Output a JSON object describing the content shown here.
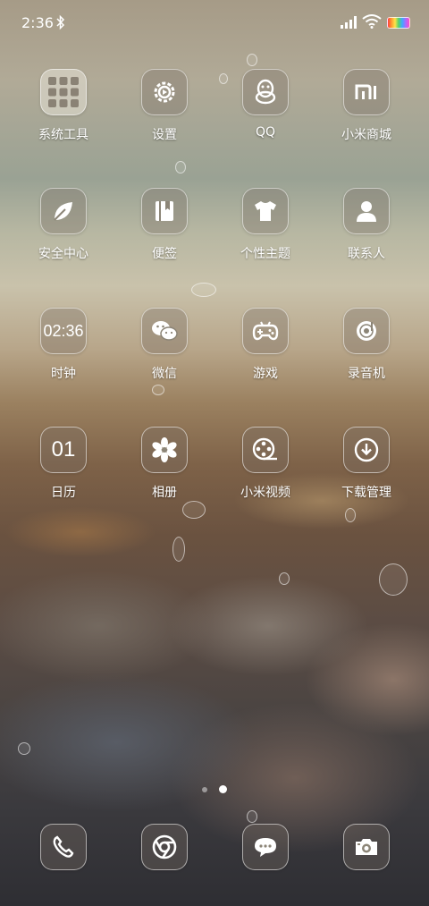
{
  "status_bar": {
    "time": "2:36",
    "icons": [
      "bluetooth-icon",
      "signal-icon",
      "wifi-icon",
      "battery-icon"
    ]
  },
  "apps": [
    {
      "label": "系统工具",
      "icon": "folder-grid-icon"
    },
    {
      "label": "设置",
      "icon": "gear-icon"
    },
    {
      "label": "QQ",
      "icon": "penguin-icon"
    },
    {
      "label": "小米商城",
      "icon": "mi-logo-icon"
    },
    {
      "label": "安全中心",
      "icon": "leaf-icon"
    },
    {
      "label": "便签",
      "icon": "notebook-icon"
    },
    {
      "label": "个性主题",
      "icon": "tshirt-icon"
    },
    {
      "label": "联系人",
      "icon": "person-icon"
    },
    {
      "label": "时钟",
      "icon_text": "02:36"
    },
    {
      "label": "微信",
      "icon": "chat-bubbles-icon"
    },
    {
      "label": "游戏",
      "icon": "gamepad-icon"
    },
    {
      "label": "录音机",
      "icon": "recorder-icon"
    },
    {
      "label": "日历",
      "icon_text": "01"
    },
    {
      "label": "相册",
      "icon": "flower-icon"
    },
    {
      "label": "小米视频",
      "icon": "film-reel-icon"
    },
    {
      "label": "下载管理",
      "icon": "download-icon"
    }
  ],
  "dock": [
    {
      "icon": "phone-icon"
    },
    {
      "icon": "browser-icon"
    },
    {
      "icon": "message-icon"
    },
    {
      "icon": "camera-icon"
    }
  ],
  "page_indicator": {
    "pages": 2,
    "current": 2
  }
}
